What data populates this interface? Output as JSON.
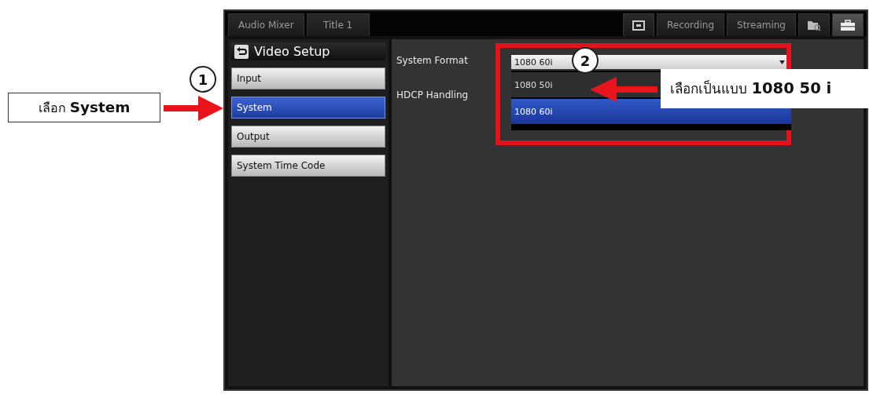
{
  "tabs": [
    {
      "kind": "text",
      "label": "Audio Mixer",
      "selected": false
    },
    {
      "kind": "text",
      "label": "Title 1",
      "selected": false
    },
    {
      "kind": "icon",
      "selected": false
    },
    {
      "kind": "text",
      "label": "Recording",
      "selected": false
    },
    {
      "kind": "text",
      "label": "Streaming",
      "selected": false
    },
    {
      "kind": "icon",
      "selected": false
    },
    {
      "kind": "icon",
      "selected": true
    }
  ],
  "sidebar": {
    "title": "Video Setup",
    "items": [
      {
        "label": "Input",
        "selected": false
      },
      {
        "label": "System",
        "selected": true
      },
      {
        "label": "Output",
        "selected": false
      },
      {
        "label": "System Time Code",
        "selected": false
      }
    ]
  },
  "settings": [
    {
      "label": "System Format",
      "kind": "dropdown",
      "value": "1080 60i",
      "expanded": true,
      "options": [
        {
          "label": "1080 50i",
          "selected": false
        },
        {
          "label": "1080 60i",
          "selected": true
        }
      ]
    },
    {
      "label": "HDCP Handling",
      "kind": "label"
    }
  ],
  "annotations": [
    {
      "marker": "1",
      "callout": "เลือก **System**"
    },
    {
      "marker": "2",
      "callout": "เลือกเป็นแบบ **1080 50 i**"
    }
  ]
}
